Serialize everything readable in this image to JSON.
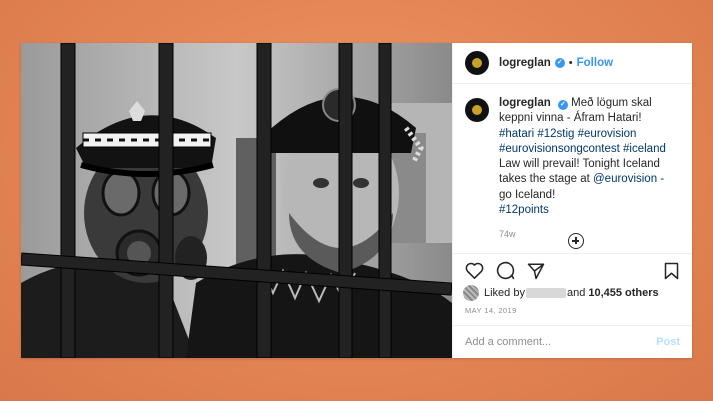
{
  "post": {
    "username": "logreglan",
    "verified_icon": "verified-badge-icon",
    "separator": "•",
    "follow_label": "Follow",
    "caption": {
      "intro": "Með lögum skal keppni vinna - Áfram Hatari!",
      "hashtags_1": "#hatari #12stig #eurovision",
      "hashtags_2": "#eurovisionsongcontest #iceland",
      "line_a": "Law will prevail! Tonight Iceland takes the stage at",
      "mention": "@eurovision",
      "line_b": "- go Iceland!",
      "hashtags_3": "#12points"
    },
    "timestamp": "74w",
    "actions": {
      "like_icon": "heart-icon",
      "comment_icon": "comment-icon",
      "share_icon": "share-icon",
      "save_icon": "bookmark-icon"
    },
    "likes": {
      "prefix": "Liked by",
      "suffix": "and",
      "count_text": "10,455 others"
    },
    "date": "MAY 14, 2019",
    "comment_placeholder": "Add a comment...",
    "post_button": "Post"
  }
}
